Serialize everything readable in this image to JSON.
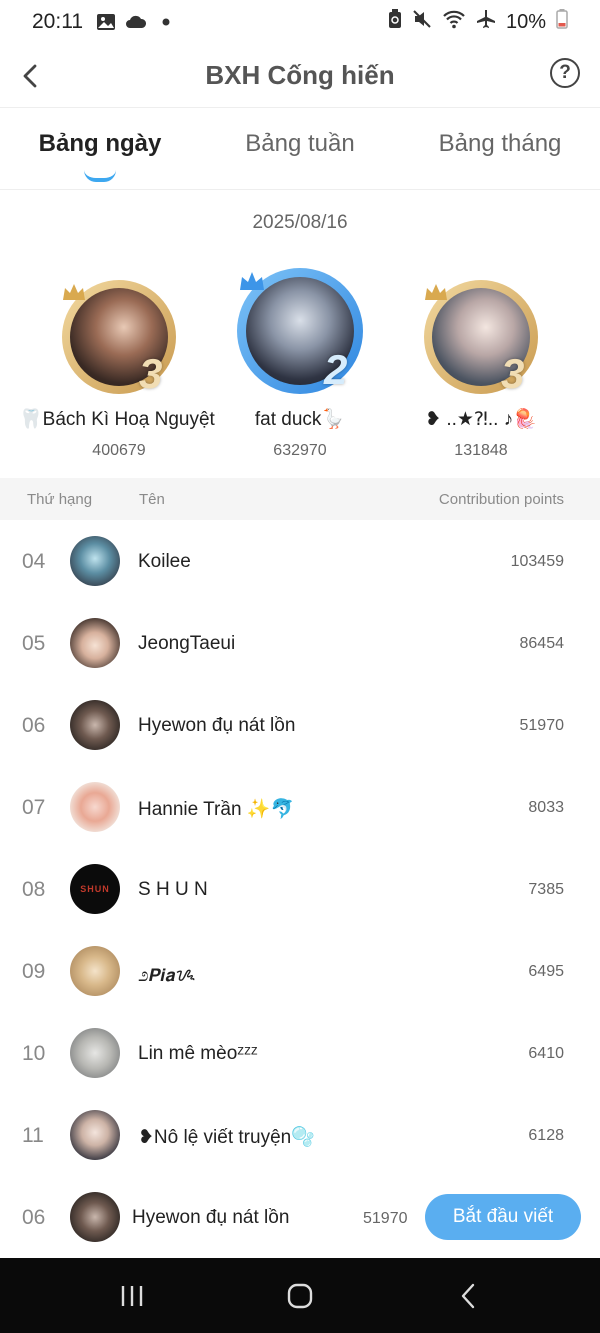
{
  "status_bar": {
    "time": "20:11",
    "battery": "10%"
  },
  "header": {
    "title": "BXH Cống hiến",
    "help": "?"
  },
  "tabs": [
    {
      "label": "Bảng ngày",
      "active": true
    },
    {
      "label": "Bảng tuần",
      "active": false
    },
    {
      "label": "Bảng tháng",
      "active": false
    }
  ],
  "date": "2025/08/16",
  "podium": [
    {
      "rank_badge": "3",
      "name": "🦷Bách Kì Hoạ Nguyệt🦷",
      "score": "400679",
      "ring": "gold"
    },
    {
      "rank_badge": "2",
      "name": "fat duck🪿",
      "score": "632970",
      "ring": "blue"
    },
    {
      "rank_badge": "3",
      "name": "❥ ..★⁈.. ♪🪼",
      "score": "131848",
      "ring": "gold"
    }
  ],
  "list_header": {
    "rank": "Thứ hạng",
    "name": "Tên",
    "points": "Contribution points"
  },
  "rows": [
    {
      "rank": "04",
      "name": "Koilee",
      "score": "103459"
    },
    {
      "rank": "05",
      "name": "JeongTaeui",
      "score": "86454"
    },
    {
      "rank": "06",
      "name": "Hyewon đụ nát lồn",
      "score": "51970"
    },
    {
      "rank": "07",
      "name": "Hannie Trần ✨🐬",
      "score": "8033"
    },
    {
      "rank": "08",
      "name": "S H U N",
      "score": "7385"
    },
    {
      "rank": "09",
      "name": "೨𝙋𝙞𝙖ᝰ",
      "score": "6495"
    },
    {
      "rank": "10",
      "name": "Lin mê mèoᶻᶻᶻ",
      "score": "6410"
    },
    {
      "rank": "11",
      "name": "❥Nô lệ viết truyện🫧",
      "score": "6128"
    }
  ],
  "my_row": {
    "rank": "06",
    "name": "Hyewon đụ nát lồn",
    "score": "51970",
    "button": "Bắt đầu viết"
  },
  "colors": {
    "accent": "#3ea8f0",
    "button": "#5aaef0",
    "gold": "#d9b36a",
    "blue_ring": "#3d95e8"
  }
}
